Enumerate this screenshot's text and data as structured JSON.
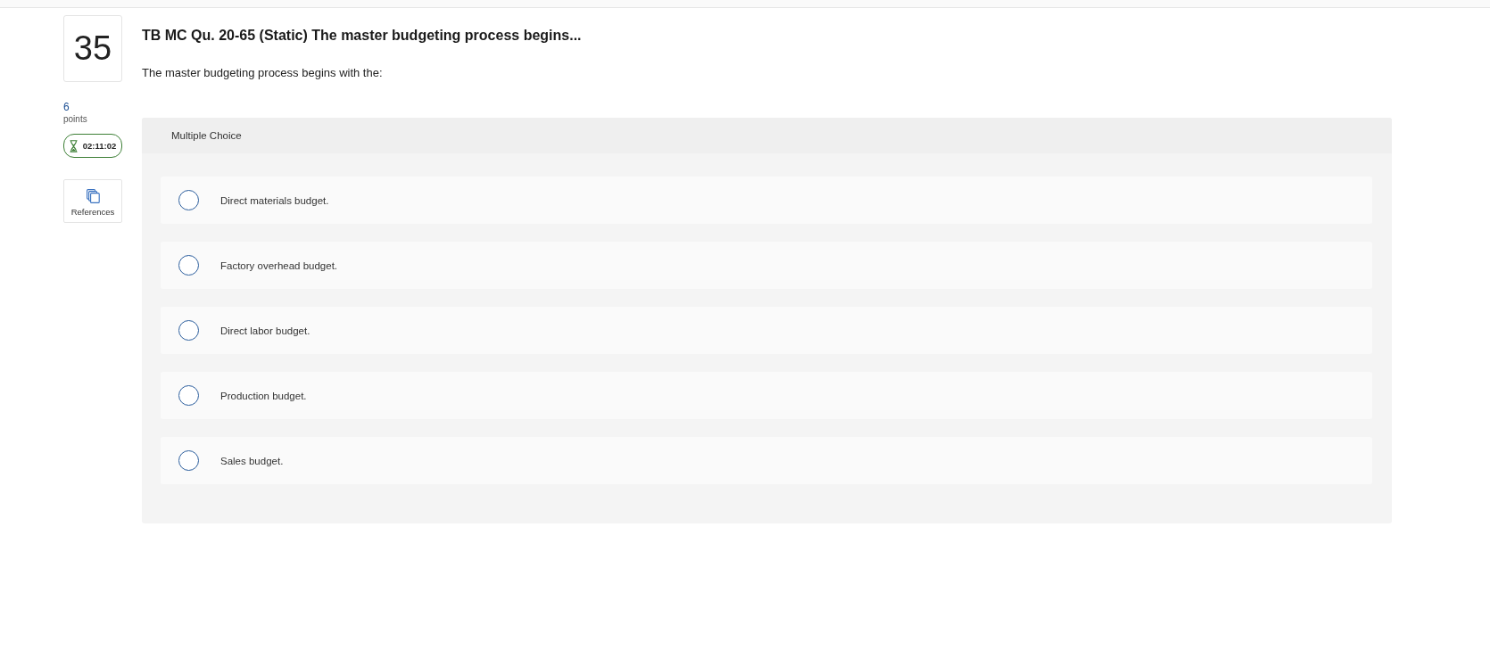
{
  "question": {
    "number": "35",
    "title": "TB MC Qu. 20-65 (Static) The master budgeting process begins...",
    "prompt": "The master budgeting process begins with the:"
  },
  "points": {
    "value": "6",
    "label": "points"
  },
  "timer": {
    "time": "02:11:02"
  },
  "references": {
    "label": "References"
  },
  "answer_panel": {
    "type_label": "Multiple Choice",
    "choices": [
      {
        "label": "Direct materials budget.",
        "selected": false
      },
      {
        "label": "Factory overhead budget.",
        "selected": false
      },
      {
        "label": "Direct labor budget.",
        "selected": false
      },
      {
        "label": "Production budget.",
        "selected": false
      },
      {
        "label": "Sales budget.",
        "selected": false
      }
    ]
  }
}
